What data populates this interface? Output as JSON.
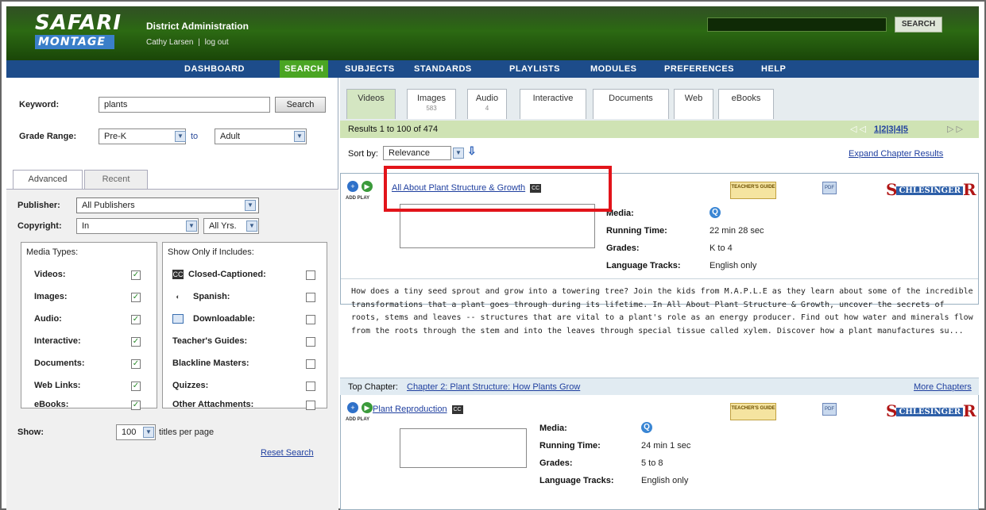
{
  "header": {
    "logo_top": "SAFARI",
    "logo_bottom": "MONTAGE",
    "title": "District Administration",
    "user": "Cathy Larsen",
    "separator": "|",
    "logout": "log out",
    "search_button": "SEARCH",
    "search_value": ""
  },
  "nav": {
    "items": [
      "DASHBOARD",
      "SEARCH",
      "SUBJECTS",
      "STANDARDS",
      "PLAYLISTS",
      "MODULES",
      "PREFERENCES",
      "HELP"
    ],
    "active": "SEARCH"
  },
  "left": {
    "keyword_label": "Keyword:",
    "keyword_value": "plants",
    "search_button": "Search",
    "grade_label": "Grade Range:",
    "grade_from": "Pre-K",
    "grade_to_label": "to",
    "grade_to": "Adult",
    "tabs": [
      "Advanced",
      "Recent"
    ],
    "publisher_label": "Publisher:",
    "publisher_value": "All Publishers",
    "copyright_label": "Copyright:",
    "copyright_value": "In",
    "copyright_years": "All Yrs.",
    "media_types_title": "Media Types:",
    "media_types": [
      "Videos:",
      "Images:",
      "Audio:",
      "Interactive:",
      "Documents:",
      "Web Links:",
      "eBooks:"
    ],
    "show_only_title": "Show Only if Includes:",
    "show_only": [
      "Closed-Captioned:",
      "Spanish:",
      "Downloadable:",
      "Teacher's Guides:",
      "Blackline Masters:",
      "Quizzes:",
      "Other Attachments:"
    ],
    "show_label": "Show:",
    "show_value": "100",
    "show_suffix": "titles per page",
    "reset": "Reset Search",
    "check_mark": "✓"
  },
  "right": {
    "tabs": [
      {
        "label": "Videos",
        "count": ""
      },
      {
        "label": "Images",
        "count": "583"
      },
      {
        "label": "Audio",
        "count": "4"
      },
      {
        "label": "Interactive",
        "count": ""
      },
      {
        "label": "Documents",
        "count": ""
      },
      {
        "label": "Web",
        "count": ""
      },
      {
        "label": "eBooks",
        "count": ""
      }
    ],
    "results_text": "Results 1 to 100 of 474",
    "pagination": "1|2|3|4|5",
    "sort_label": "Sort by:",
    "sort_value": "Relevance",
    "expand": "Expand Chapter Results",
    "add_play": "ADD PLAY",
    "badge_text": "TEACHER'S GUIDE",
    "doc_text": "PDF",
    "publisher_logo_a": "S",
    "publisher_logo_mid": "CHLESINGER",
    "publisher_logo_b": "R",
    "cc": "CC",
    "media_icon": "Q",
    "results": [
      {
        "title": "All About Plant Structure & Growth",
        "media_label": "Media:",
        "running_label": "Running Time:",
        "running": "22 min 28 sec",
        "grades_label": "Grades:",
        "grades": "K to 4",
        "lang_label": "Language Tracks:",
        "lang": "English only",
        "description": "How does a tiny seed sprout and grow into a towering tree? Join the kids from M.A.P.L.E as they learn about some of the incredible transformations that a plant goes through during its lifetime. In All About Plant Structure & Growth, uncover the secrets of roots, stems and leaves -- structures that are vital to a plant's role as an energy producer. Find out how water and minerals flow from the roots through the stem and into the leaves through special tissue called xylem. Discover how a plant manufactures su...",
        "top_chapter_label": "Top Chapter:",
        "top_chapter": "Chapter 2: Plant Structure: How Plants Grow",
        "more_chapters": "More Chapters"
      },
      {
        "title": "Plant Reproduction",
        "media_label": "Media:",
        "running_label": "Running Time:",
        "running": "24 min 1 sec",
        "grades_label": "Grades:",
        "grades": "5 to 8",
        "lang_label": "Language Tracks:",
        "lang": "English only"
      }
    ]
  },
  "colors": {
    "header_green": "#2c6a13",
    "nav_blue": "#1d4c8a",
    "active_green": "#4aa523",
    "highlight_red": "#e2141a"
  }
}
